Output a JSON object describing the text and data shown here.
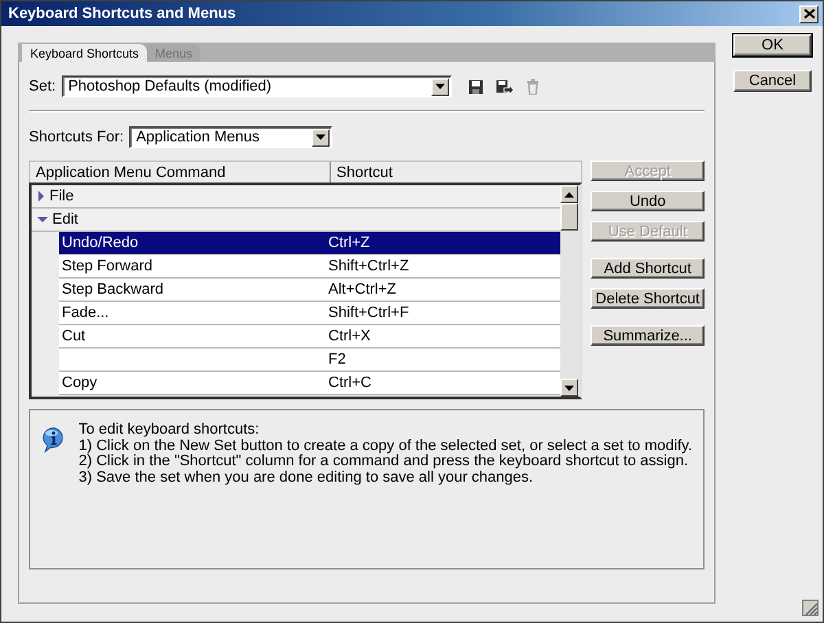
{
  "window": {
    "title": "Keyboard Shortcuts and Menus"
  },
  "tabs": [
    {
      "label": "Keyboard Shortcuts",
      "selected": true
    },
    {
      "label": "Menus",
      "selected": false
    }
  ],
  "set": {
    "label": "Set:",
    "value": "Photoshop Defaults (modified)"
  },
  "shortcuts_for": {
    "label": "Shortcuts For:",
    "value": "Application Menus"
  },
  "table": {
    "columns": [
      "Application Menu Command",
      "Shortcut"
    ],
    "rows": [
      {
        "command": "File",
        "expanded": false,
        "selected": false
      },
      {
        "command": "Edit",
        "expanded": true,
        "selected": false,
        "children": [
          {
            "command": "Undo/Redo",
            "shortcut": "Ctrl+Z",
            "selected": true
          },
          {
            "command": "Step Forward",
            "shortcut": "Shift+Ctrl+Z",
            "selected": false
          },
          {
            "command": "Step Backward",
            "shortcut": "Alt+Ctrl+Z",
            "selected": false
          },
          {
            "command": "Fade...",
            "shortcut": "Shift+Ctrl+F",
            "selected": false
          },
          {
            "command": "Cut",
            "shortcut": "Ctrl+X",
            "selected": false
          },
          {
            "shortcut": "F2",
            "selected": false
          },
          {
            "command": "Copy",
            "shortcut": "Ctrl+C",
            "selected": false
          }
        ]
      }
    ]
  },
  "side_buttons": [
    {
      "label": "Accept",
      "disabled": true
    },
    {
      "label": "Undo",
      "disabled": false
    },
    {
      "label": "Use Default",
      "disabled": true
    },
    {
      "label": "Add Shortcut",
      "disabled": false
    },
    {
      "label": "Delete Shortcut",
      "disabled": false
    },
    {
      "label": "Summarize...",
      "disabled": false
    }
  ],
  "info": {
    "lines": [
      "To edit keyboard shortcuts:",
      "1) Click on the New Set button to create a copy of the selected set, or select a set to modify.",
      "2) Click in the \"Shortcut\" column for a command and press the keyboard shortcut to assign.",
      "3) Save the set when you are done editing to save all your changes."
    ]
  },
  "dialog_buttons": [
    {
      "label": "OK",
      "default": true
    },
    {
      "label": "Cancel",
      "default": false
    }
  ]
}
